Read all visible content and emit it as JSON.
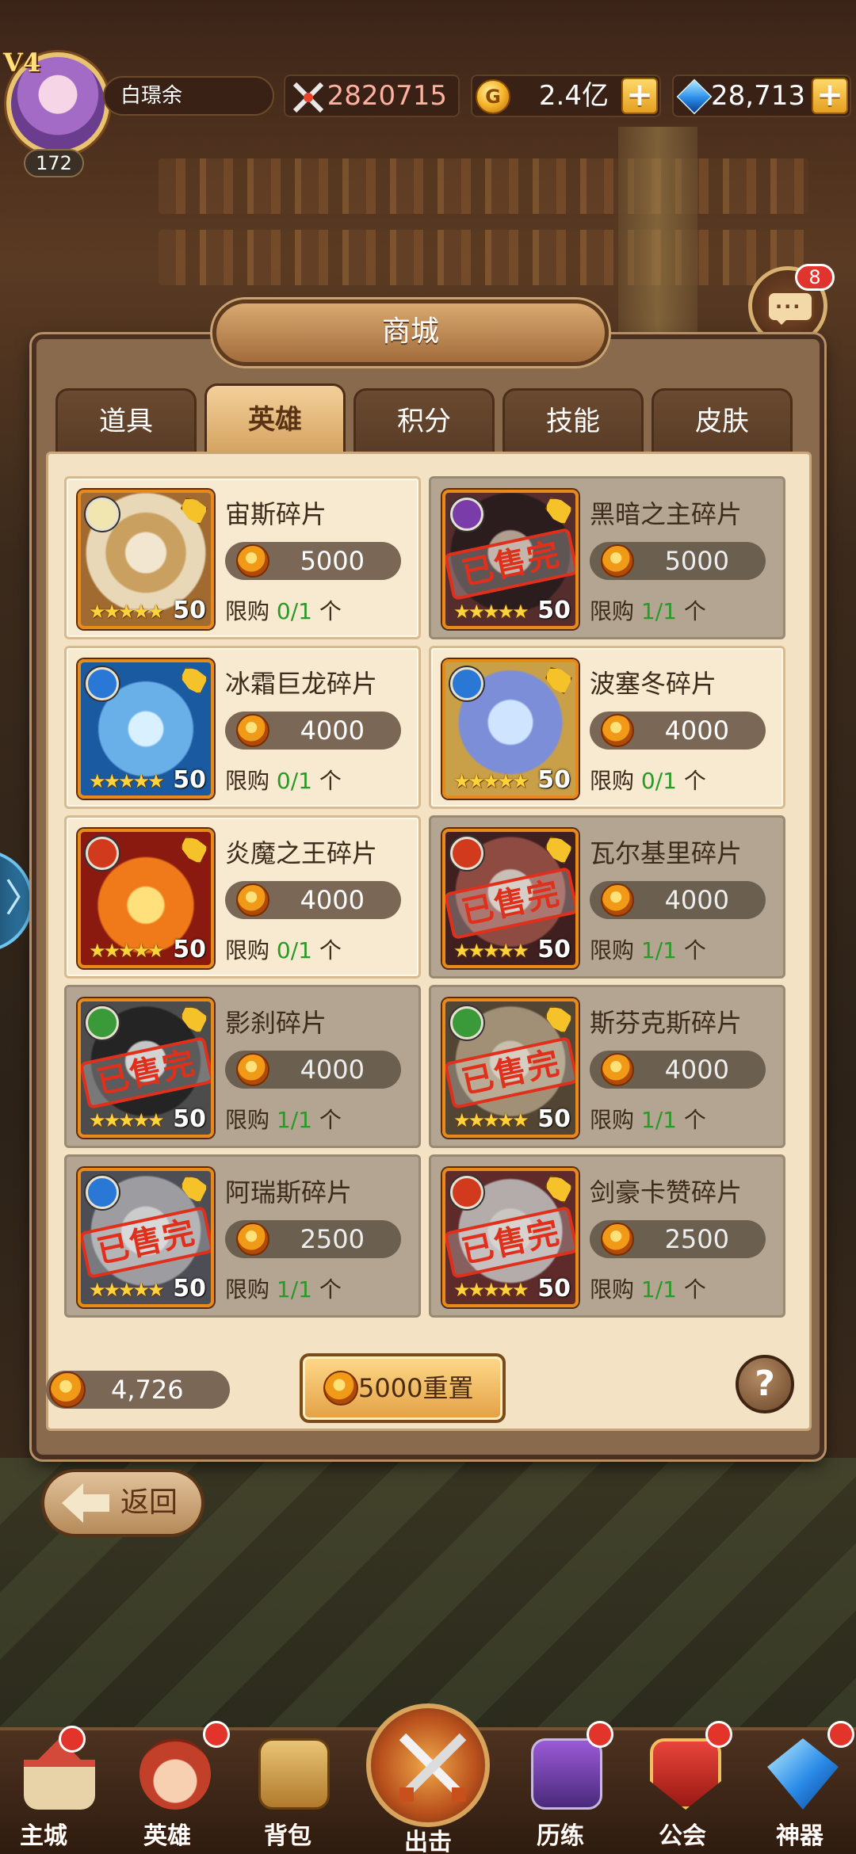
{
  "top_bar": {
    "vip": "V4",
    "level": "172",
    "player_name": "白璟余",
    "power": "2820715",
    "gold": "2.4亿",
    "gems": "28,713",
    "plus": "+"
  },
  "chat": {
    "badge": "8",
    "dots": "···"
  },
  "side_arrow": "〉",
  "shop": {
    "title": "商城",
    "tabs": [
      {
        "label": "道具"
      },
      {
        "label": "英雄"
      },
      {
        "label": "积分"
      },
      {
        "label": "技能"
      },
      {
        "label": "皮肤"
      }
    ],
    "active_tab": "英雄",
    "limit_label": "限购",
    "limit_unit": "个",
    "sold_out_stamp": "已售完",
    "items": [
      {
        "name": "宙斯碎片",
        "price": "5000",
        "limit_used": "0",
        "limit_total": "/1",
        "level": "50",
        "stars": "★★★★★",
        "element": "light",
        "sold_out": false
      },
      {
        "name": "黑暗之主碎片",
        "price": "5000",
        "limit_used": "1",
        "limit_total": "/1",
        "level": "50",
        "stars": "★★★★★",
        "element": "dark",
        "sold_out": true
      },
      {
        "name": "冰霜巨龙碎片",
        "price": "4000",
        "limit_used": "0",
        "limit_total": "/1",
        "level": "50",
        "stars": "★★★★★",
        "element": "water",
        "sold_out": false
      },
      {
        "name": "波塞冬碎片",
        "price": "4000",
        "limit_used": "0",
        "limit_total": "/1",
        "level": "50",
        "stars": "★★★★★",
        "element": "water",
        "sold_out": false
      },
      {
        "name": "炎魔之王碎片",
        "price": "4000",
        "limit_used": "0",
        "limit_total": "/1",
        "level": "50",
        "stars": "★★★★★",
        "element": "fire",
        "sold_out": false
      },
      {
        "name": "瓦尔基里碎片",
        "price": "4000",
        "limit_used": "1",
        "limit_total": "/1",
        "level": "50",
        "stars": "★★★★★",
        "element": "fire",
        "sold_out": true
      },
      {
        "name": "影刹碎片",
        "price": "4000",
        "limit_used": "1",
        "limit_total": "/1",
        "level": "50",
        "stars": "★★★★★",
        "element": "wind",
        "sold_out": true
      },
      {
        "name": "斯芬克斯碎片",
        "price": "4000",
        "limit_used": "1",
        "limit_total": "/1",
        "level": "50",
        "stars": "★★★★★",
        "element": "wind",
        "sold_out": true
      },
      {
        "name": "阿瑞斯碎片",
        "price": "2500",
        "limit_used": "1",
        "limit_total": "/1",
        "level": "50",
        "stars": "★★★★★",
        "element": "water",
        "sold_out": true
      },
      {
        "name": "剑豪卡赞碎片",
        "price": "2500",
        "limit_used": "1",
        "limit_total": "/1",
        "level": "50",
        "stars": "★★★★★",
        "element": "fire",
        "sold_out": true
      }
    ],
    "currency_amount": "4,726",
    "reset_label": "5000重置",
    "help": "?"
  },
  "back_label": "返回",
  "nav": [
    {
      "label": "主城",
      "icon": "castle-icon"
    },
    {
      "label": "英雄",
      "icon": "hero-icon"
    },
    {
      "label": "背包",
      "icon": "bag-icon"
    },
    {
      "label": "出击",
      "icon": "crossed-swords-icon"
    },
    {
      "label": "历练",
      "icon": "tower-icon"
    },
    {
      "label": "公会",
      "icon": "guild-shield-icon"
    },
    {
      "label": "神器",
      "icon": "artifact-crystal-icon"
    }
  ],
  "colors": {
    "accent_gold": "#e3a020",
    "limit_green": "#2a9a26",
    "stamp_red": "#e0301c",
    "panel_bg": "#f3e3c4",
    "element_light": "#f2e6b0",
    "element_dark": "#7a3ca8",
    "element_water": "#2a78d6",
    "element_fire": "#d23a1e",
    "element_wind": "#3a9a3a"
  }
}
